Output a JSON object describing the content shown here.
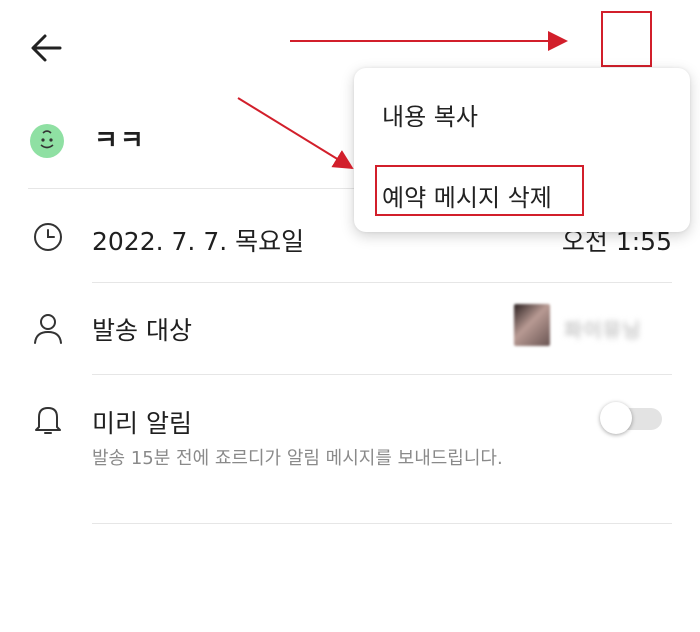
{
  "header": {
    "back_icon": "arrow-left-icon",
    "more_icon": "more-vertical-icon"
  },
  "title_row": {
    "emoji_icon": "smile-face-emoji-icon",
    "title": "ㅋㅋ"
  },
  "date_row": {
    "icon": "clock-icon",
    "date": "2022. 7. 7. 목요일",
    "time": "오전 1:55"
  },
  "recipient_row": {
    "icon": "person-icon",
    "label": "발송 대상",
    "name": "파이뮤닝"
  },
  "alarm_row": {
    "icon": "bell-icon",
    "label": "미리 알림",
    "description": "발송 15분 전에 죠르디가 알림 메시지를 보내드립니다.",
    "toggle_on": false
  },
  "menu": {
    "items": [
      {
        "label": "내용 복사"
      },
      {
        "label": "예약 메시지 삭제"
      }
    ]
  },
  "annotations": {
    "color": "#d21f2b"
  },
  "colors": {
    "emoji_badge": "#8fe0a3",
    "description_text": "#8a8a8a",
    "divider": "#e6e6e6"
  }
}
